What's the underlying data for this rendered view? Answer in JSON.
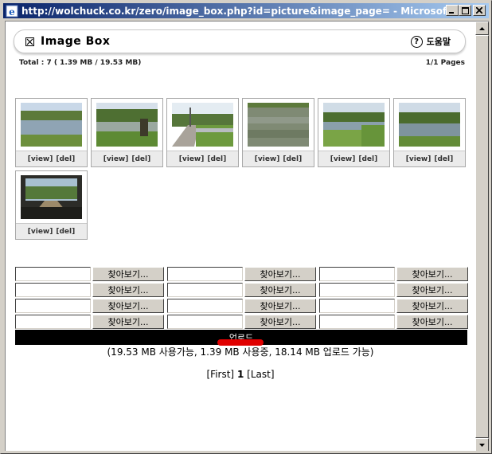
{
  "window": {
    "title": "http://wolchuck.co.kr/zero/image_box.php?id=picture&image_page= - Microsoft Internet E..."
  },
  "header": {
    "title": "Image  Box",
    "help_label": "도움말"
  },
  "stats": {
    "total": "Total : 7 ( 1.39 MB / 19.53 MB)",
    "pages": "1/1 Pages"
  },
  "thumbnails": [
    {
      "view": "[view]",
      "del": "[del]"
    },
    {
      "view": "[view]",
      "del": "[del]"
    },
    {
      "view": "[view]",
      "del": "[del]"
    },
    {
      "view": "[view]",
      "del": "[del]"
    },
    {
      "view": "[view]",
      "del": "[del]"
    },
    {
      "view": "[view]",
      "del": "[del]"
    },
    {
      "view": "[view]",
      "del": "[del]"
    }
  ],
  "upload": {
    "browse_label": "찾아보기...",
    "upload_label": "업로드",
    "usage": "(19.53 MB 사용가능, 1.39 MB 사용중, 18.14 MB 업로드 가능)"
  },
  "pager": {
    "first": "[First]",
    "current": "1",
    "last": "[Last]"
  }
}
